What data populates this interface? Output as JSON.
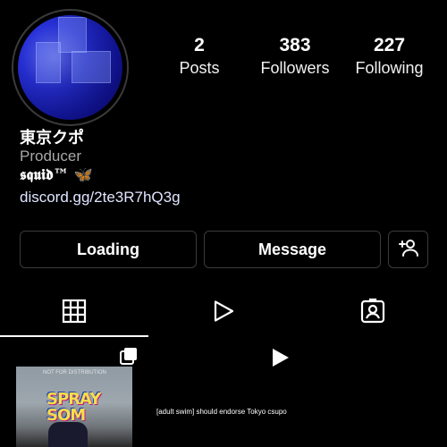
{
  "profile": {
    "name": "東京クポ",
    "category": "Producer",
    "bio_text": "𝖘𝖖𝖚𝖎𝖉™",
    "bio_emoji": "🦋",
    "link": "discord.gg/2te3R7hQ3g"
  },
  "stats": {
    "posts": {
      "value": "2",
      "label": "Posts"
    },
    "followers": {
      "value": "383",
      "label": "Followers"
    },
    "following": {
      "value": "227",
      "label": "Following"
    }
  },
  "actions": {
    "primary_label": "Loading",
    "message_label": "Message",
    "add_user_icon": "add-user-icon"
  },
  "tabs": [
    {
      "icon": "grid-icon",
      "active": true
    },
    {
      "icon": "reels-play-icon",
      "active": false
    },
    {
      "icon": "tagged-icon",
      "active": false
    }
  ],
  "posts": [
    {
      "type": "carousel",
      "thumbnail_text": "SPRAY SOM",
      "thumbnail_small_text": "NOT FOR DISTRIBUTION"
    },
    {
      "type": "video",
      "caption": "[adult swim] should endorse Tokyo csupo"
    }
  ]
}
